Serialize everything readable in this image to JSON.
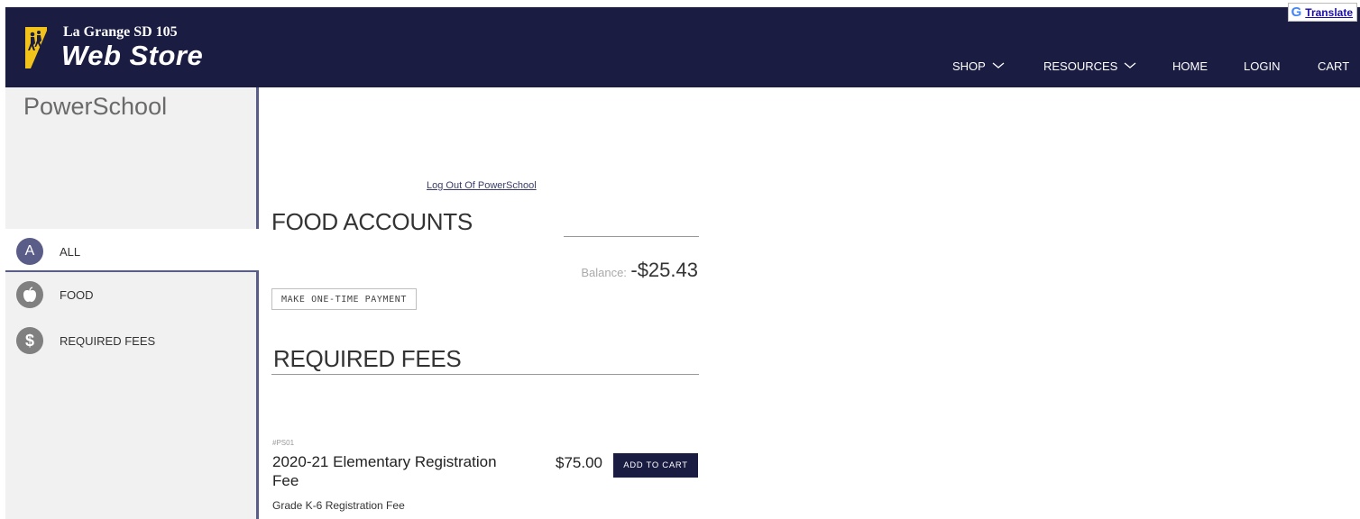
{
  "header": {
    "district": "La Grange SD 105",
    "store_name": "Web Store",
    "background": "#1a1c42",
    "logo_icon": "school-children-crossing-icon",
    "nav": [
      {
        "label": "SHOP",
        "has_dropdown": true
      },
      {
        "label": "RESOURCES",
        "has_dropdown": true
      },
      {
        "label": "HOME",
        "has_dropdown": false
      },
      {
        "label": "LOGIN",
        "has_dropdown": false
      },
      {
        "label": "CART",
        "has_dropdown": false
      }
    ],
    "translate": {
      "icon": "google-g-icon",
      "label": "Translate"
    }
  },
  "sidebar": {
    "title": "PowerSchool",
    "categories": [
      {
        "label": "ALL",
        "icon_text": "A",
        "icon": "letter-a-icon",
        "active": true,
        "color": "#5a5d88"
      },
      {
        "label": "FOOD",
        "icon": "apple-icon",
        "active": false,
        "color": "#808080"
      },
      {
        "label": "REQUIRED FEES",
        "icon": "dollar-icon",
        "icon_text": "$",
        "active": false,
        "color": "#808080"
      }
    ]
  },
  "content": {
    "logout_link": "Log Out Of PowerSchool",
    "food_section": {
      "heading": "FOOD ACCOUNTS",
      "balance_label": "Balance:",
      "balance_value": "-$25.43",
      "payment_button": "MAKE ONE-TIME PAYMENT"
    },
    "fees_section": {
      "heading": "REQUIRED FEES",
      "items": [
        {
          "sku": "#PS01",
          "name": "2020-21 Elementary Registration Fee",
          "price": "$75.00",
          "button": "ADD TO CART",
          "description": "Grade K-6 Registration Fee"
        }
      ]
    }
  },
  "colors": {
    "navy": "#1a1c42",
    "accent": "#5a5d88",
    "sidebar_bg": "#f1f1f2"
  }
}
